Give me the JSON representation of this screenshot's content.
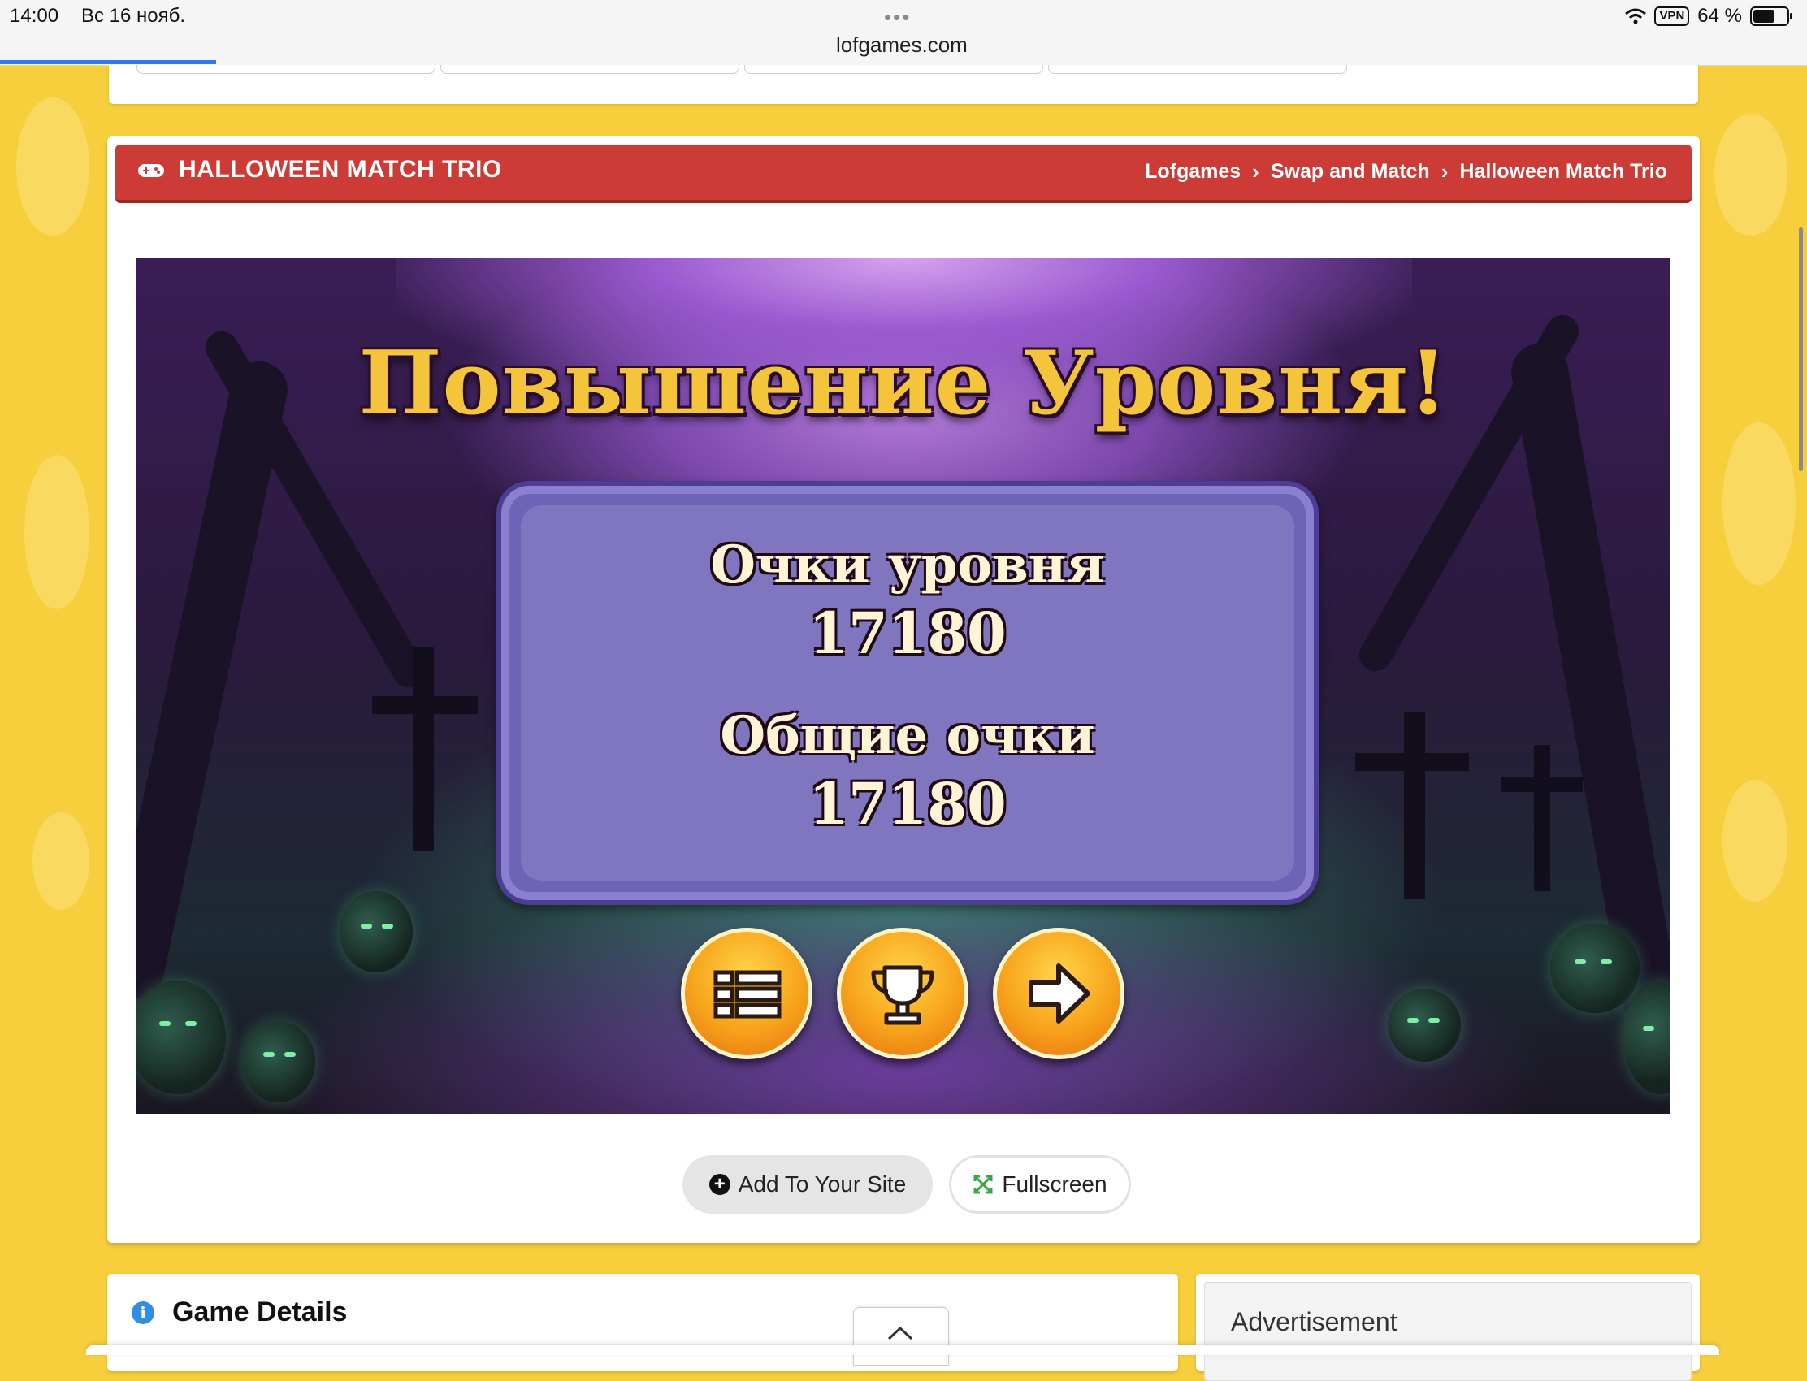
{
  "status_bar": {
    "time": "14:00",
    "date": "Вс 16 нояб.",
    "url": "lofgames.com",
    "vpn": "VPN",
    "battery": "64 %"
  },
  "header": {
    "title": "HALLOWEEN MATCH TRIO",
    "breadcrumbs": [
      "Lofgames",
      "Swap and Match",
      "Halloween Match Trio"
    ]
  },
  "game": {
    "headline": "Повышение Уровня!",
    "level_score_label": "Очки уровня",
    "level_score_value": "17180",
    "total_score_label": "Общие очки",
    "total_score_value": "17180",
    "buttons": [
      "menu-list-icon",
      "trophy-icon",
      "next-arrow-icon"
    ]
  },
  "actions": {
    "add_label": "Add To Your Site",
    "fullscreen_label": "Fullscreen"
  },
  "details": {
    "title": "Game Details"
  },
  "ad": {
    "title": "Advertisement"
  },
  "colors": {
    "header_red": "#cc3b35",
    "page_yellow": "#f7cf3d",
    "title_gold": "#f4c53a",
    "panel_purple": "#6f63b7",
    "button_orange": "#f7a31b"
  }
}
